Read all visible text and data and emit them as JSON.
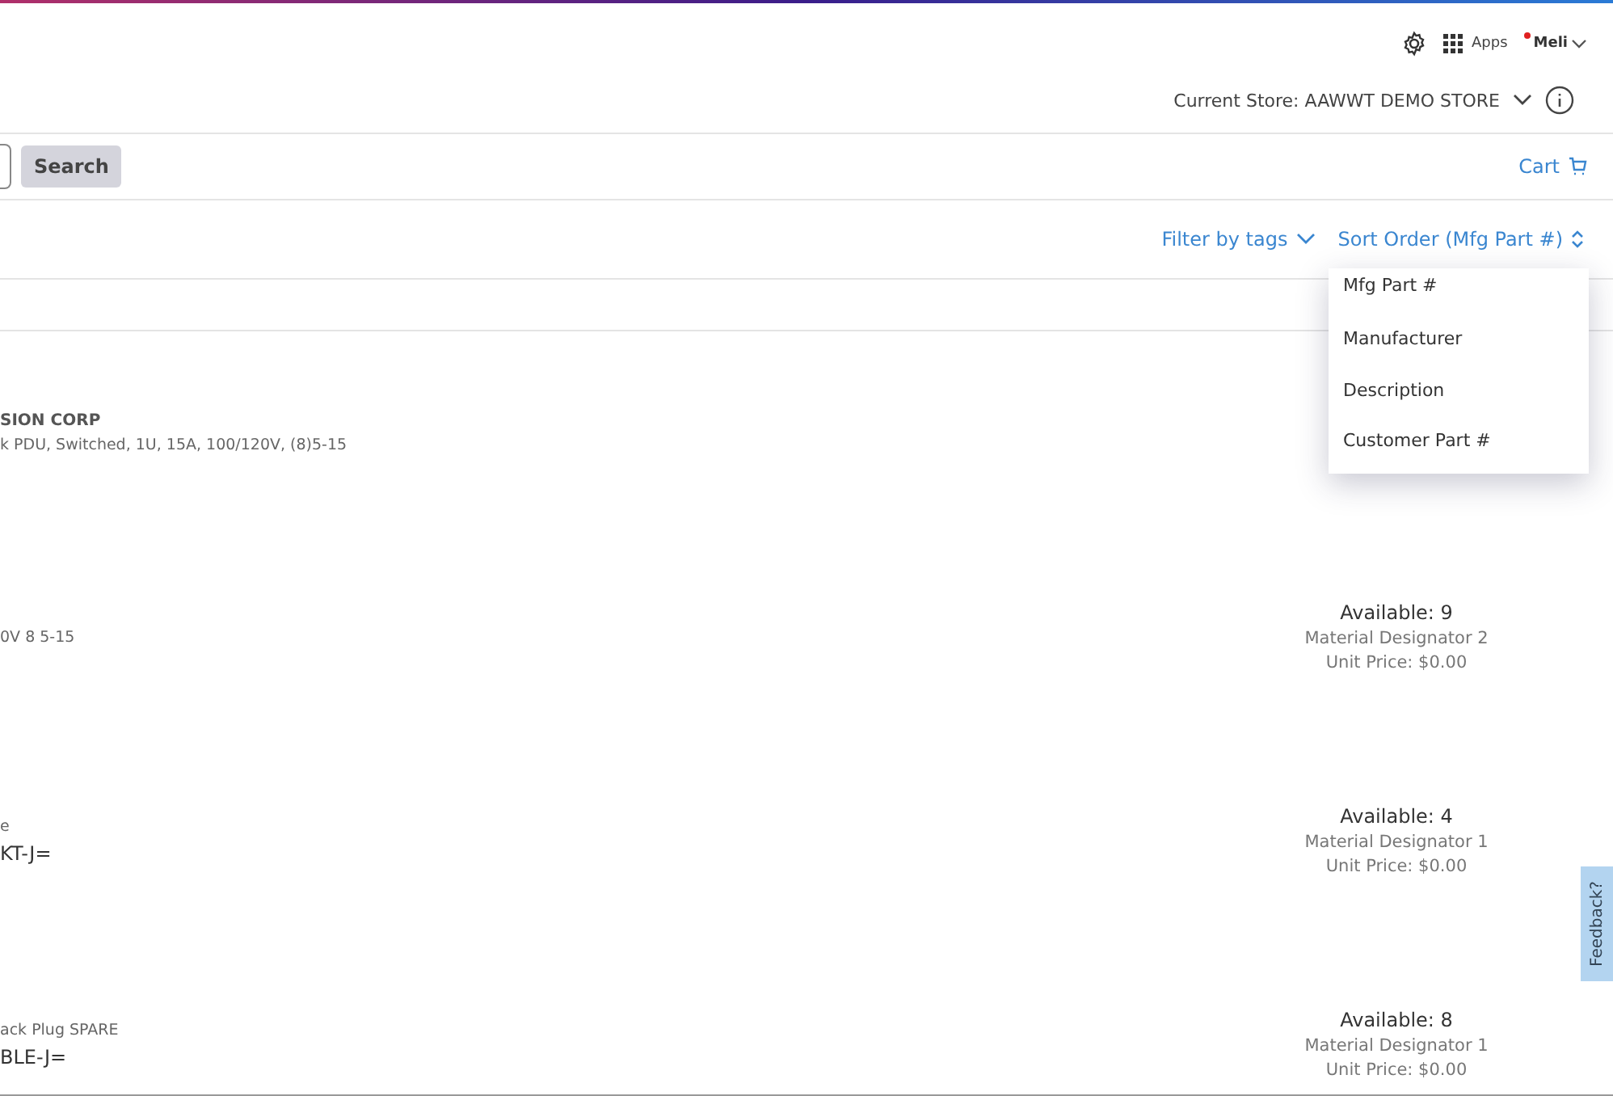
{
  "header": {
    "apps_label": "Apps",
    "user": "Meli",
    "notification": true
  },
  "store": {
    "label": "Current Store: AAWWT DEMO STORE"
  },
  "search": {
    "button": "Search"
  },
  "cart": {
    "label": "Cart"
  },
  "filter": {
    "label": "Filter by tags"
  },
  "sort": {
    "label": "Sort Order (Mfg Part #)",
    "options": [
      "Mfg Part #",
      "Manufacturer",
      "Description",
      "Customer Part #"
    ]
  },
  "products": [
    {
      "manufacturer": "SION CORP",
      "description": "k PDU, Switched, 1U, 15A, 100/120V, (8)5-15"
    },
    {
      "description": "0V 8 5-15",
      "available": "Available: 9",
      "designator": "Material Designator 2",
      "price": "Unit Price: $0.00"
    },
    {
      "description": "e",
      "part": "KT-J=",
      "available": "Available: 4",
      "designator": "Material Designator 1",
      "price": "Unit Price: $0.00"
    },
    {
      "description": "ack Plug SPARE",
      "part": "BLE-J=",
      "available": "Available: 8",
      "designator": "Material Designator 1",
      "price": "Unit Price: $0.00"
    }
  ],
  "feedback": {
    "label": "Feedback?"
  }
}
